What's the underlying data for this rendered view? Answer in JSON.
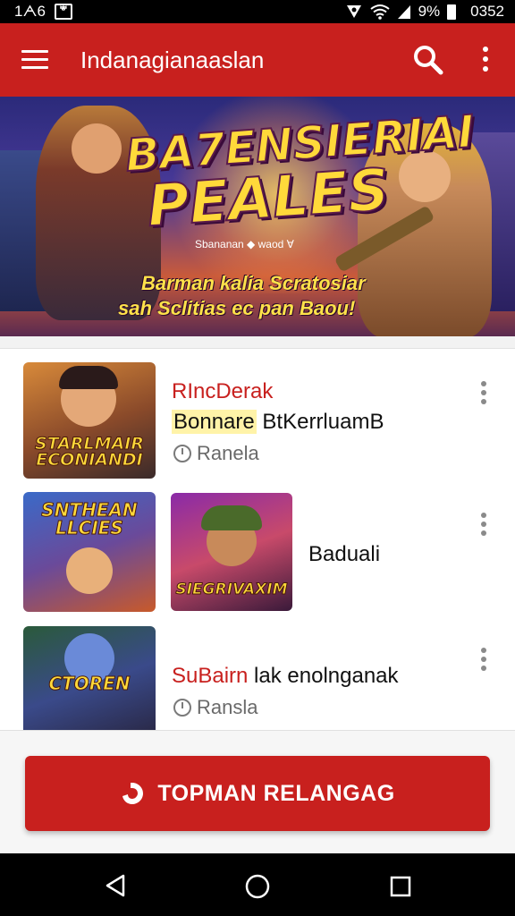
{
  "status_bar": {
    "time_left": "1ᗅ6",
    "notification_glyph": "ᄬ",
    "battery_text": "9%",
    "clock": "0352"
  },
  "app_bar": {
    "title": "Indanagianaaslan",
    "icons": [
      "menu-icon",
      "search-icon",
      "more-vert-icon"
    ]
  },
  "banner": {
    "headline_line1": "BA7ENSIERIAI",
    "headline_line2": "PEALES",
    "sub_badge": "Sbananan ◆ waod ∀",
    "tagline_line1": "Barman kalia Scratosiar",
    "tagline_line2": "sah Sclitias ec pan Baou!"
  },
  "list": {
    "items": [
      {
        "thumb_caption": "STARLMAIR\nECONIANDI",
        "title": "RIncDerak",
        "highlight": "Bonnare",
        "title_rest": " BtKerrluamB",
        "subtitle": "Ranela"
      },
      {
        "thumb_caption": "SNTHEAN\nLLCIES",
        "thumb2_caption": "SIEGRIVAXIM",
        "title": "Baduali"
      },
      {
        "thumb_caption": "CTOREN",
        "title_red": "SuBairn",
        "title_rest": " lak enolnganak",
        "subtitle": "Ransla"
      }
    ]
  },
  "cta": {
    "label": "TOPMAN RELANGAG",
    "icon": "badge-icon"
  },
  "colors": {
    "primary": "#c8201e",
    "banner_text": "#ffd93a",
    "highlight": "#fff3a8"
  }
}
